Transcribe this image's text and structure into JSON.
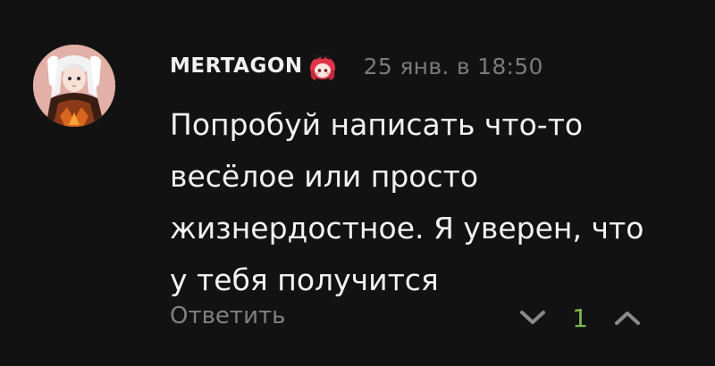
{
  "comment": {
    "author": "MERTAGON",
    "timestamp": "25 янв. в 18:50",
    "text_lines": [
      "Попробуй написать что-то",
      "весёлое или просто",
      "жизнердостное. Я уверен, что",
      "у тебя получится"
    ],
    "reply_label": "Ответить",
    "score": "1"
  },
  "icons": {
    "avatar": "user-avatar",
    "badge": "anime-girl-badge-icon",
    "downvote": "chevron-down-icon",
    "upvote": "chevron-up-icon"
  },
  "colors": {
    "background": "#121212",
    "text": "#f2f2f2",
    "muted": "#7a7a7a",
    "score": "#79b84f"
  }
}
